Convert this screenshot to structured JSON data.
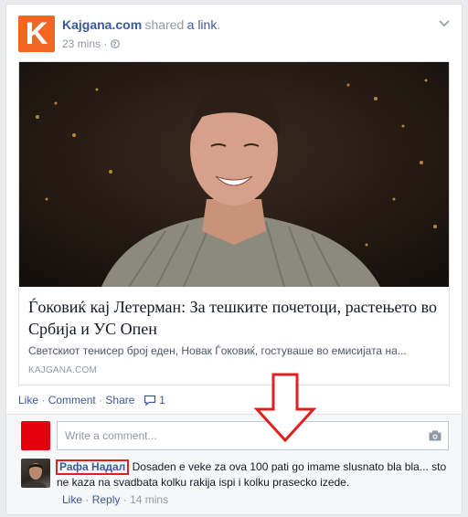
{
  "post": {
    "page_name": "Kajgana.com",
    "action_text": "shared",
    "action_link": "a link",
    "punct": ".",
    "time": "23 mins",
    "meta_sep": "·",
    "logo_letter": "K",
    "logo_color": "#f26522"
  },
  "link": {
    "title": "Ѓоковиќ кај Летерман: За тешките почетоци, растењето во Србија и УС Опен",
    "description": "Светскиот тенисер број еден, Новак Ѓоковиќ, гостуваше во емисијата на...",
    "domain": "KAJGANA.COM"
  },
  "actions": {
    "like": "Like",
    "comment": "Comment",
    "share": "Share",
    "dot": "·",
    "comment_count": "1"
  },
  "composer": {
    "placeholder": "Write a comment..."
  },
  "comment": {
    "author": "Рафа Надал",
    "text": "Dosaden e veke za ova 100 pati go imame slusnato bla bla... sto ne kaza na svadbata kolku rakija ispi i kolku prasecko izede.",
    "like": "Like",
    "reply": "Reply",
    "dot": "·",
    "time": "14 mins"
  },
  "colors": {
    "link_blue": "#3b5998",
    "annotation_red": "#e02020"
  }
}
